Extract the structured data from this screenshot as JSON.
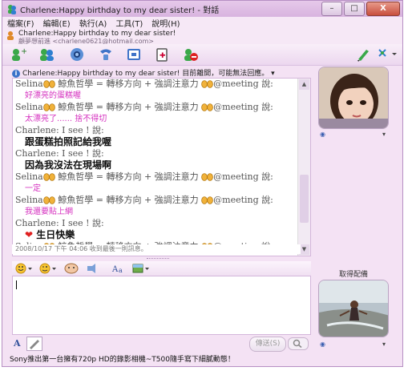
{
  "window": {
    "title": "Charlene:Happy birthday to my dear sister! - 對話",
    "buttons": {
      "minimize": "–",
      "maximize": "□",
      "close": "X"
    }
  },
  "menu": [
    "檔案(F)",
    "編輯(E)",
    "執行(A)",
    "工具(T)",
    "說明(H)"
  ],
  "contact": {
    "name": "Charlene:Happy birthday to my dear sister!",
    "email": "顧夢想前進 <charlene0621@hotmail.com>"
  },
  "notice": "Charlene:Happy birthday to my dear sister! 目前離開，可能無法回應。",
  "chat": [
    {
      "sender": "Selina",
      "middle": "鯨魚哲學 = 轉移方向 + 強調注意力",
      "suffix": "@meeting 說:",
      "text": "好漂亮的蛋糕喔",
      "style": "pink",
      "emoticons": true
    },
    {
      "sender": "Selina",
      "middle": "鯨魚哲學 = 轉移方向 + 強調注意力",
      "suffix": "@meeting 說:",
      "text": "太漂亮了...... 捨不得切",
      "style": "pink",
      "emoticons": true
    },
    {
      "sender": "Charlene: I see ! 說:",
      "text": "跟蛋糕拍照記給我喔",
      "style": "black",
      "emoticons": false
    },
    {
      "sender": "Charlene: I see ! 說:",
      "text": "因為我沒法在現場啊",
      "style": "black",
      "emoticons": false
    },
    {
      "sender": "Selina",
      "middle": "鯨魚哲學 = 轉移方向 + 強調注意力",
      "suffix": "@meeting 說:",
      "text": "一定",
      "style": "pink",
      "emoticons": true
    },
    {
      "sender": "Selina",
      "middle": "鯨魚哲學 = 轉移方向 + 強調注意力",
      "suffix": "@meeting 說:",
      "text": "我還要貼上網",
      "style": "pink",
      "emoticons": true
    },
    {
      "sender": "Charlene: I see ! 說:",
      "text": "生日快樂",
      "style": "black",
      "emoticons": false,
      "heart": true
    },
    {
      "sender": "Selina",
      "middle": "鯨魚哲學 = 轉移方向 + 強調注意力",
      "suffix": "@meeting 說:",
      "text": "",
      "style": "pink",
      "emoticons": true
    }
  ],
  "last_message": "2008/10/17 下午 04:06 收到最後一則訊息。",
  "input": {
    "value": ""
  },
  "buttons": {
    "send": "傳送(S)"
  },
  "avatar": {
    "my_label": "取得配備"
  },
  "ad": "Sony推出第一台擁有720p HD的錄影相機~T500隨手寫下細膩動態！",
  "colors": {
    "accent": "#d52fbf",
    "frame": "#f4e2f4"
  }
}
